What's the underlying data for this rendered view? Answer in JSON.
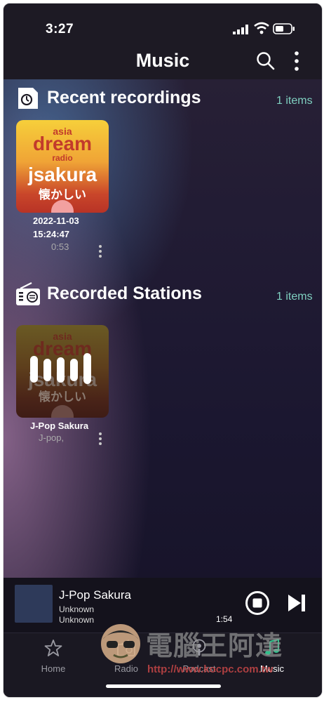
{
  "status": {
    "time": "3:27"
  },
  "header": {
    "title": "Music"
  },
  "recent": {
    "title": "Recent recordings",
    "count": "1 items",
    "item": {
      "logo_top": "asia",
      "logo_main": "dream",
      "logo_radio": "radio",
      "logo_station": "jsakura",
      "logo_jp": "懐かしい",
      "date": "2022-11-03",
      "time": "15:24:47",
      "duration": "0:53"
    }
  },
  "stations": {
    "title": "Recorded Stations",
    "count": "1 items",
    "item": {
      "logo_top": "asia",
      "logo_main": "dream",
      "logo_station": "jsakura",
      "logo_jp": "懐かしい",
      "name": "J-Pop Sakura",
      "genre": "J-pop,"
    }
  },
  "player": {
    "title": "J-Pop Sakura",
    "line2": "Unknown",
    "line3": "Unknown",
    "elapsed": "1:54"
  },
  "tabs": [
    {
      "label": "Home",
      "icon": "star-icon"
    },
    {
      "label": "Radio",
      "icon": "radio-icon"
    },
    {
      "label": "Podcast",
      "icon": "podcast-icon"
    },
    {
      "label": "Music",
      "icon": "music-note-icon"
    }
  ],
  "watermark": {
    "text": "電腦王阿達",
    "url": "http://www.kocpc.com.tw"
  },
  "colors": {
    "accent": "#7fd0c0",
    "music_tab": "#2fc08a"
  }
}
